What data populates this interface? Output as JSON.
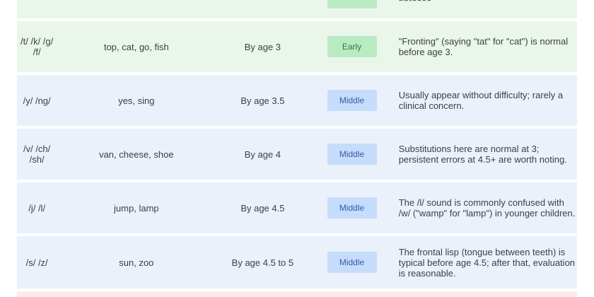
{
  "rows": [
    {
      "sounds": "",
      "words": "",
      "age": "",
      "stage": "",
      "notes": "phrases.",
      "tone": "green"
    },
    {
      "sounds": "/t/ /k/ /g/ /f/",
      "words": "top, cat, go, fish",
      "age": "By age 3",
      "stage": "Early",
      "notes": "\"Fronting\" (saying \"tat\" for \"cat\") is normal before age 3.",
      "tone": "green"
    },
    {
      "sounds": "/y/ /ng/",
      "words": "yes, sing",
      "age": "By age 3.5",
      "stage": "Middle",
      "notes": "Usually appear without difficulty; rarely a clinical concern.",
      "tone": "blue"
    },
    {
      "sounds": "/v/ /ch/ /sh/",
      "words": "van, cheese, shoe",
      "age": "By age 4",
      "stage": "Middle",
      "notes": "Substitutions here are normal at 3; persistent errors at 4.5+ are worth noting.",
      "tone": "blue"
    },
    {
      "sounds": "/j/ /l/",
      "words": "jump, lamp",
      "age": "By age 4.5",
      "stage": "Middle",
      "notes": "The /l/ sound is commonly confused with /w/ (\"wamp\" for \"lamp\") in younger children.",
      "tone": "blue"
    },
    {
      "sounds": "/s/ /z/",
      "words": "sun, zoo",
      "age": "By age 4.5 to 5",
      "stage": "Middle",
      "notes": "The frontal lisp (tongue between teeth) is typical before age 4.5; after that, evaluation is reasonable.",
      "tone": "blue"
    }
  ],
  "colors": {
    "early_bg": "#b8ebc2",
    "middle_bg": "#c6dcfb",
    "green_row": "#eaf6ea",
    "blue_row": "#eaf1fb"
  }
}
